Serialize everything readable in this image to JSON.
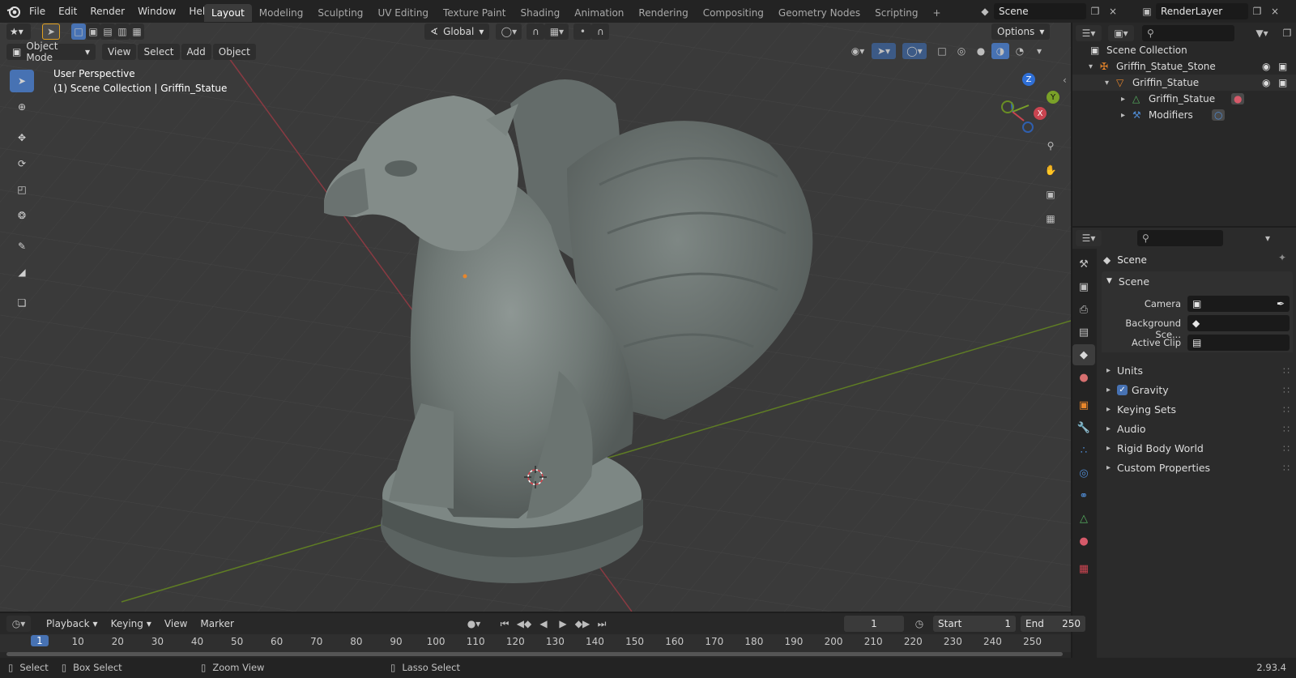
{
  "menu": [
    "File",
    "Edit",
    "Render",
    "Window",
    "Help"
  ],
  "workspaces": [
    "Layout",
    "Modeling",
    "Sculpting",
    "UV Editing",
    "Texture Paint",
    "Shading",
    "Animation",
    "Rendering",
    "Compositing",
    "Geometry Nodes",
    "Scripting"
  ],
  "active_workspace": "Layout",
  "add_workspace": "+",
  "scene_name": "Scene",
  "view_layer": "RenderLayer",
  "viewport": {
    "transform_orientation": "Global",
    "options_label": "Options",
    "mode": "Object Mode",
    "menus": [
      "View",
      "Select",
      "Add",
      "Object"
    ],
    "perspective_label": "User Perspective",
    "collection_label": "(1) Scene Collection | Griffin_Statue",
    "gizmo_axes": {
      "x": "X",
      "y": "Y",
      "z": "Z"
    }
  },
  "outliner": {
    "rows": [
      {
        "label": "Scene Collection",
        "icon": "collection-icon"
      },
      {
        "label": "Griffin_Statue_Stone",
        "icon": "armature-icon"
      },
      {
        "label": "Griffin_Statue",
        "icon": "mesh-object-icon"
      },
      {
        "label": "Griffin_Statue",
        "icon": "mesh-data-icon"
      },
      {
        "label": "Modifiers",
        "icon": "wrench-icon"
      }
    ]
  },
  "properties": {
    "header": "Scene",
    "panel": "Scene",
    "fields": [
      {
        "label": "Camera",
        "value": ""
      },
      {
        "label": "Background Sce...",
        "value": ""
      },
      {
        "label": "Active Clip",
        "value": ""
      }
    ],
    "sections": [
      "Units",
      "Gravity",
      "Keying Sets",
      "Audio",
      "Rigid Body World",
      "Custom Properties"
    ],
    "gravity_checked": true
  },
  "timeline": {
    "menus": [
      "Playback",
      "Keying",
      "View",
      "Marker"
    ],
    "current_frame": "1",
    "start_label": "Start",
    "start": "1",
    "end_label": "End",
    "end": "250",
    "ticks": [
      "1",
      "10",
      "20",
      "30",
      "40",
      "50",
      "60",
      "70",
      "80",
      "90",
      "100",
      "110",
      "120",
      "130",
      "140",
      "150",
      "160",
      "170",
      "180",
      "190",
      "200",
      "210",
      "220",
      "230",
      "240",
      "250"
    ]
  },
  "status": {
    "select": "Select",
    "box_select": "Box Select",
    "zoom_view": "Zoom View",
    "lasso_select": "Lasso Select",
    "version": "2.93.4"
  },
  "colors": {
    "accent": "#4772b3",
    "x_axis": "#c94450",
    "y_axis": "#7aa128",
    "z_axis": "#2f6fd6",
    "object_orange": "#e8862b"
  }
}
